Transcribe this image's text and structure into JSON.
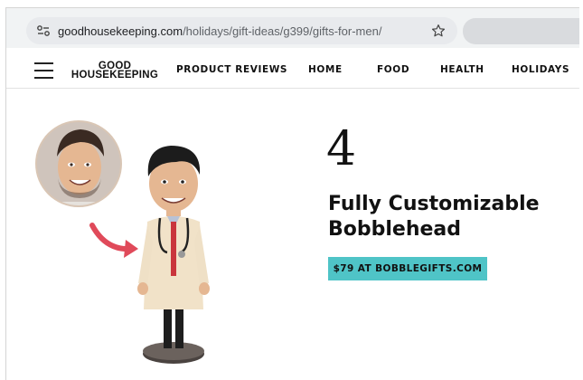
{
  "browser": {
    "url_domain": "goodhousekeeping.com",
    "url_path": "/holidays/gift-ideas/g399/gifts-for-men/",
    "site_info_icon": "tune-icon",
    "bookmark_icon": "star-icon"
  },
  "nav": {
    "menu_icon": "hamburger-menu-icon",
    "logo_line1": "GOOD",
    "logo_line2": "HOUSEKEEPING",
    "items": [
      "PRODUCT REVIEWS",
      "HOME",
      "FOOD",
      "HEALTH",
      "HOLIDAYS"
    ]
  },
  "product": {
    "number": "4",
    "title_line1": "Fully Customizable",
    "title_line2": "Bobblehead",
    "button_label": "$79 AT BOBBLEGIFTS.COM",
    "image": "bobblehead-product-image",
    "colors": {
      "button": "#4fc4c7",
      "arrow": "#e04a5a"
    }
  }
}
